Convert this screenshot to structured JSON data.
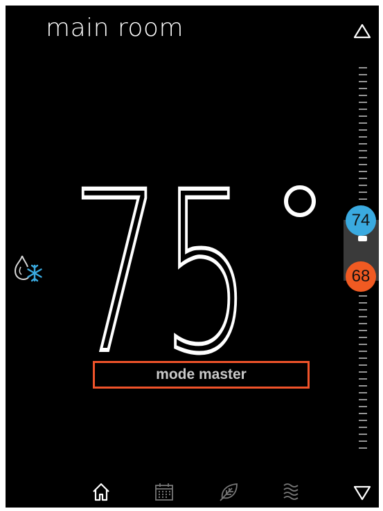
{
  "header": {
    "room_name": "main room"
  },
  "current_temperature": {
    "value": "75",
    "unit_symbol": "°"
  },
  "mode": {
    "label": "mode master",
    "icon": "heat-cool-mode-icon"
  },
  "setpoints": {
    "cool": "74",
    "heat": "68"
  },
  "colors": {
    "background": "#000000",
    "accent_box": "#f0532a",
    "cool": "#3aaae0",
    "heat": "#f05a22",
    "mode_icon_flake": "#3aaae0"
  },
  "bottom_nav": [
    "home-icon",
    "calendar-icon",
    "leaf-icon",
    "humidity-waves-icon"
  ]
}
